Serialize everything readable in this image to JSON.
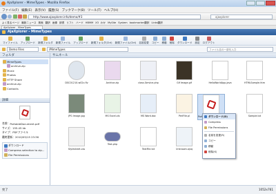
{
  "window": {
    "title": "AjaXplorer - MimeTypes - Mozilla Firefox"
  },
  "menubar": {
    "items": [
      "ファイル(F)",
      "編集(E)",
      "表示(V)",
      "履歴(S)",
      "ブックマーク(B)",
      "ツール(T)",
      "ヘルプ(H)"
    ]
  },
  "navbar": {
    "url": "http://www.ajaxplorer.info/demo/#3",
    "search_placeholder": "ajaxplorer"
  },
  "bookmarks": {
    "items": [
      "よく見るページ",
      "最新ニュース",
      "検索",
      "翻訳",
      "画像",
      "辞書",
      "リフト",
      "ハード",
      "HBMM",
      "X3",
      "わか",
      "MySite",
      "System",
      "bookmarker翻訳",
      "Links翻訳"
    ]
  },
  "tab": {
    "label": "AjaXplorer - MimeTypes"
  },
  "app": {
    "title": "AjaXplorer - MimeTypes"
  },
  "toolbar": {
    "buttons": [
      "マイファイル",
      "アップロード",
      "新規フォルダ",
      "新規ファイル",
      "アップロード",
      "新規フォルダ(Ctrl)",
      "新規ファイル(Ctrl)",
      "名前変更",
      "コピー",
      "移動",
      "削除",
      "ダウンロード",
      "設定",
      "ログアウト"
    ]
  },
  "pathbar": {
    "repo": "Demo Files",
    "path": "/MimeTypes",
    "search_placeholder": "ファイル名の一部を入力"
  },
  "tree": {
    "header": "フォルダ",
    "items": [
      "MimeTypes",
      "archive.zip",
      "Music",
      "Photos",
      "HTTP Share",
      "archive.zip",
      "Contacts"
    ]
  },
  "details": {
    "header": "詳細",
    "filename_label": "名前：",
    "filename": "PortableDocument.pdf",
    "size_label": "サイズ：",
    "size": "155.45 kb",
    "type_label": "タイプ：",
    "type": "PDFファイル",
    "modified_label": "最終更新：",
    "modified": "2010/05/15 23:36",
    "actions": [
      "ダウンロード",
      "Compress selection to zip...",
      "File Permissions"
    ]
  },
  "main": {
    "header": "サムネール",
    "files": [
      "DSC01210-w02c.flv",
      "Archive.zip",
      "class.Service.php",
      "Gif Image.gif",
      "HelloWorldApp.java",
      "HTMLSample.htm",
      "JPG Image.jpg",
      "MS Excel.xls",
      "MS Word.doc",
      "PerlFile.pl",
      "PortableDocument.pdf",
      "Sample.txt",
      "Stylesheet.css",
      "Test.php",
      "TextFile.txt",
      "Unknown.ajxq"
    ]
  },
  "context_menu": {
    "items": [
      "ダウンロード(D)",
      "Compress",
      "File Permissions",
      "名前を変更(R)",
      "コピー",
      "移動",
      "削除(K)"
    ]
  },
  "status": {
    "left": "完了",
    "right": "1052x761"
  },
  "colors": {
    "accent": "#2c5d99",
    "header": "#4b7bb7",
    "selection": "#cfe0f6",
    "pdf": "#c41d1d"
  }
}
